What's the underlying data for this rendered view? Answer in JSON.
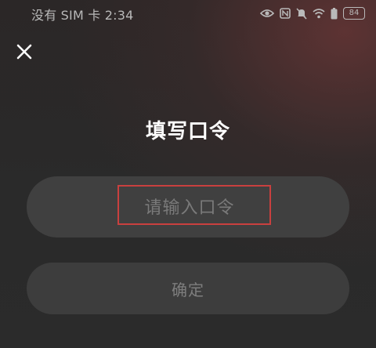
{
  "status_bar": {
    "left_text": "没有 SIM 卡 2:34",
    "battery_level": "84",
    "icons": [
      "eye-icon",
      "nfc-icon",
      "mute-icon",
      "wifi-icon",
      "battery-saver-icon",
      "battery-icon"
    ]
  },
  "header": {
    "close_icon": "close-icon"
  },
  "dialog": {
    "title": "填写口令",
    "input": {
      "value": "",
      "placeholder": "请输入口令"
    },
    "confirm_label": "确定"
  },
  "colors": {
    "background": "#2a2a2a",
    "highlight_border": "#c9403f",
    "title_text": "#ffffff"
  }
}
